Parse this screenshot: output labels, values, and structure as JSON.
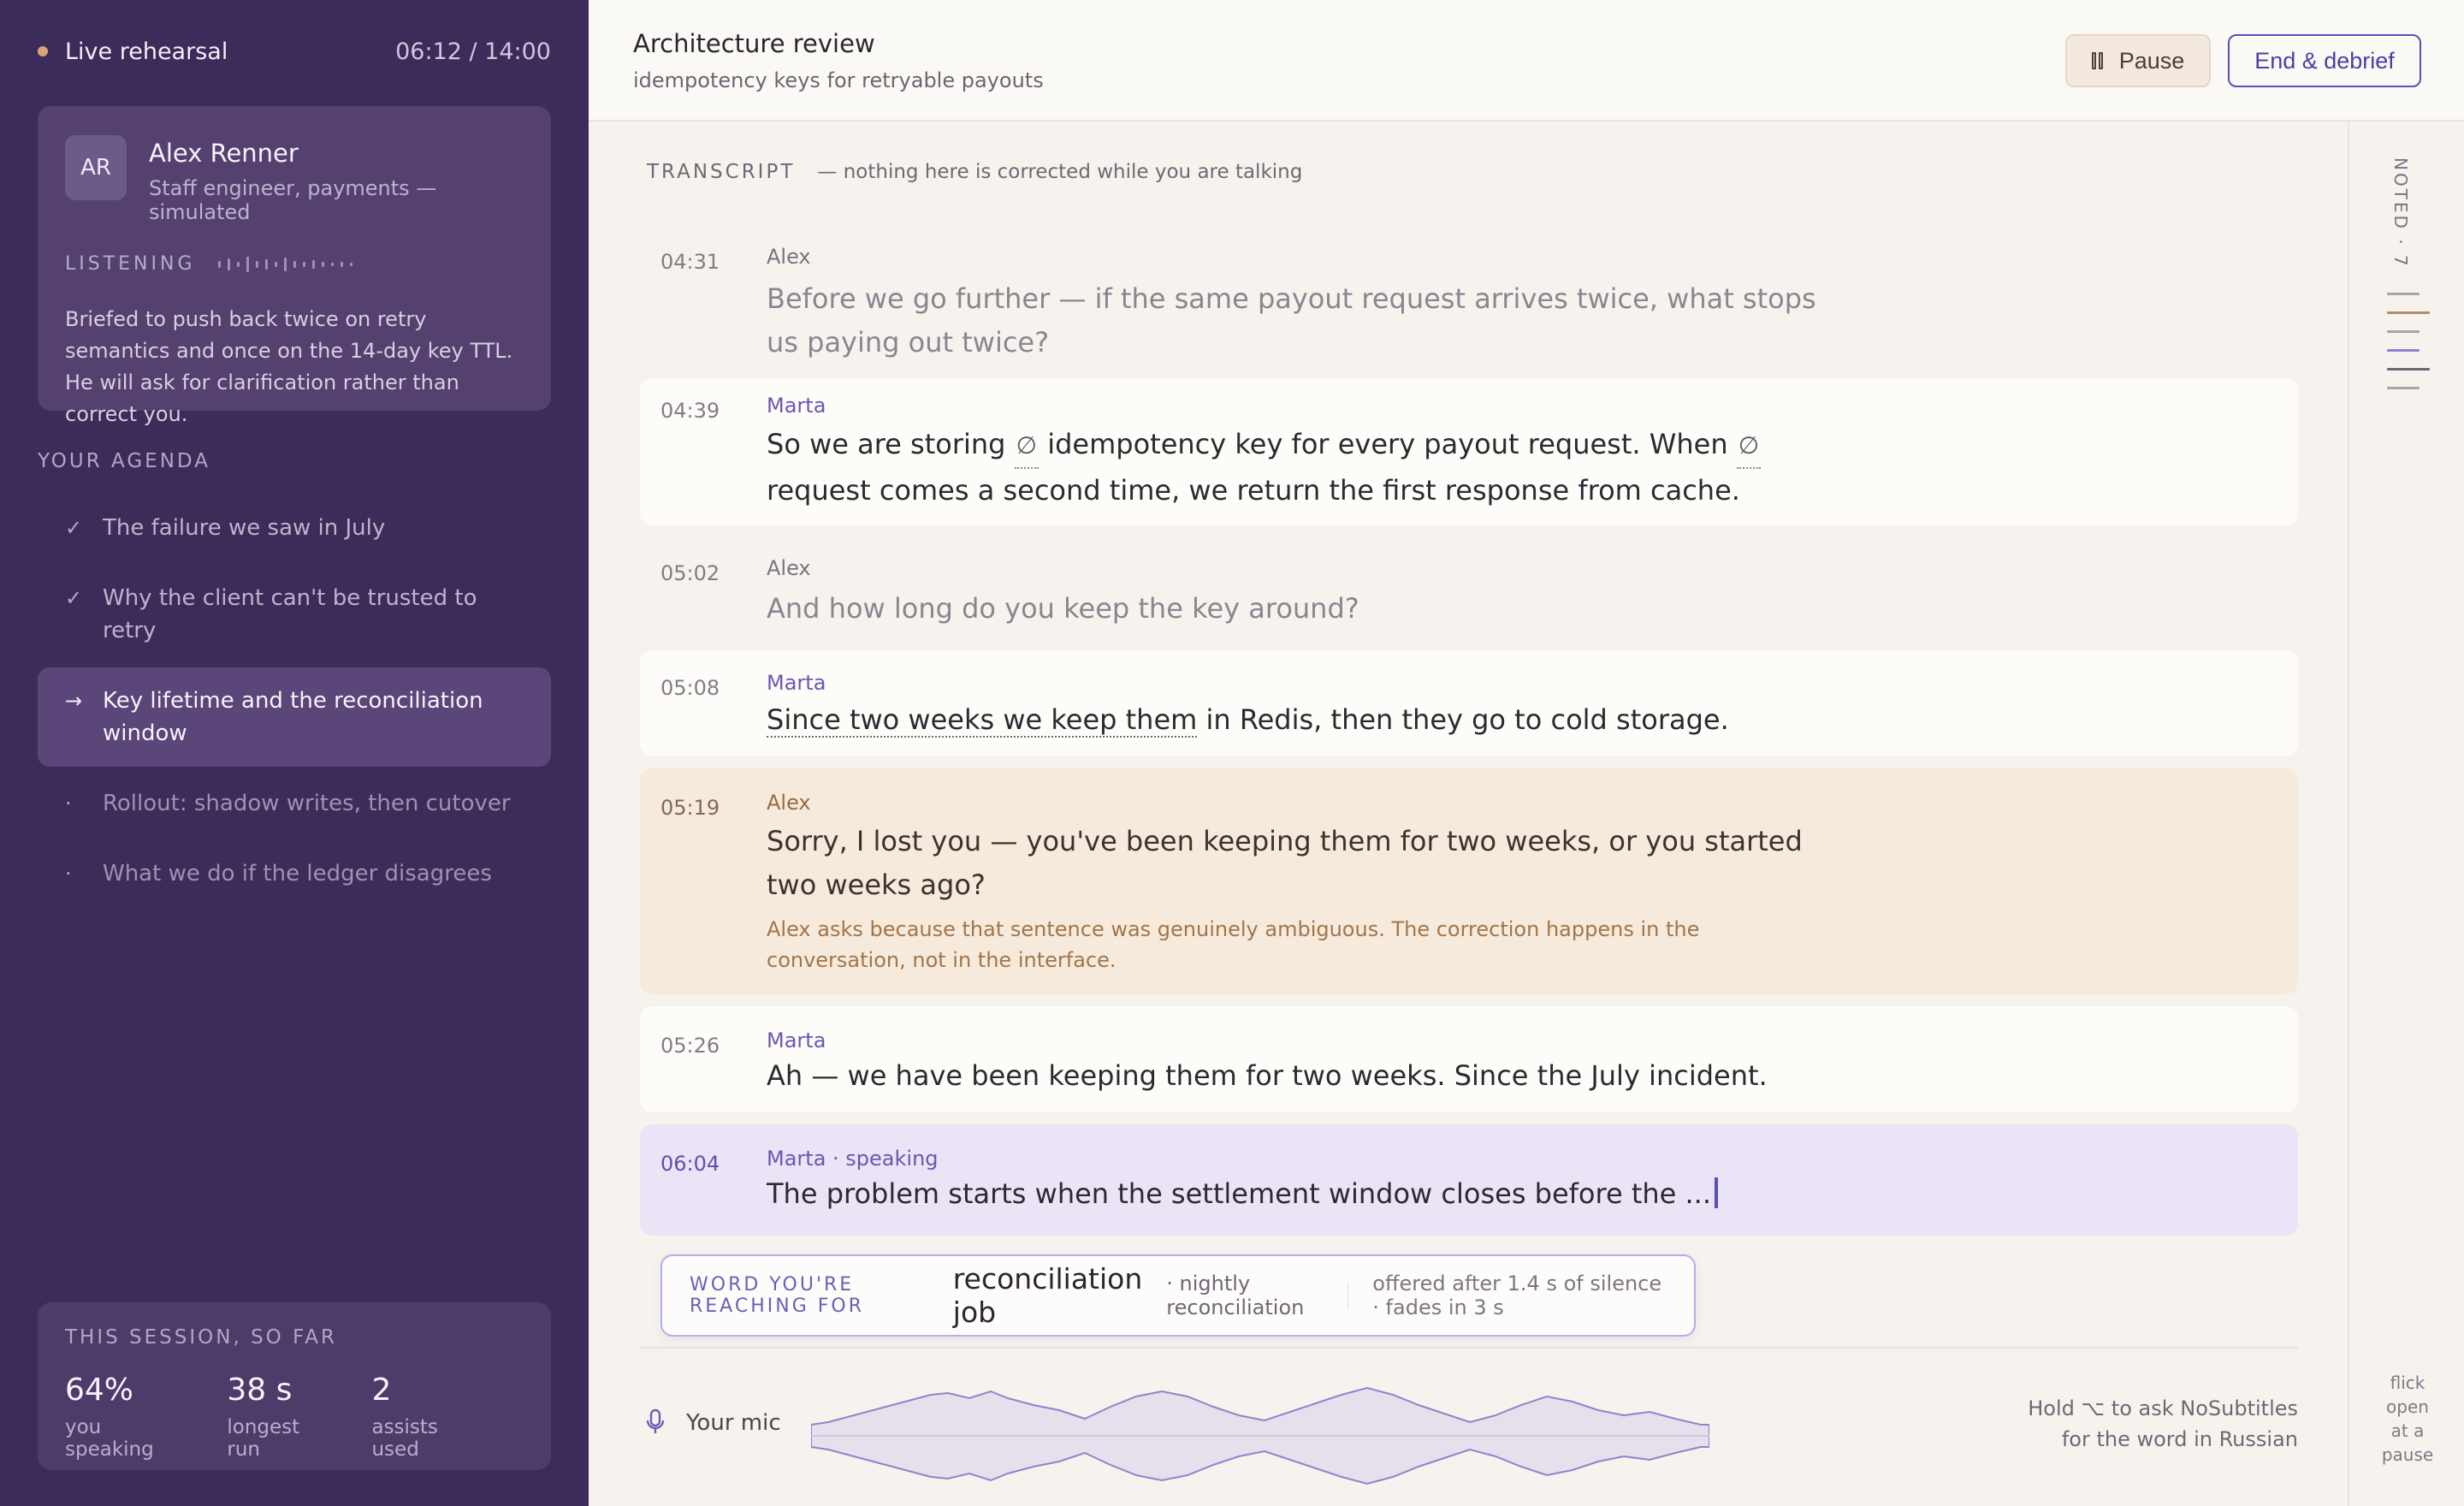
{
  "session": {
    "status": "Live rehearsal",
    "timer": "06:12 / 14:00"
  },
  "persona": {
    "initials": "AR",
    "name": "Alex Renner",
    "role": "Staff engineer, payments — simulated",
    "listening_label": "LISTENING",
    "brief": "Briefed to push back twice on retry semantics and once on the 14-day key TTL. He will ask for clarification rather than correct you."
  },
  "agenda": {
    "title": "YOUR AGENDA",
    "items": [
      {
        "label": "The failure we saw in July",
        "state": "done",
        "mark": "✓"
      },
      {
        "label": "Why the client can't be trusted to retry",
        "state": "done",
        "mark": "✓"
      },
      {
        "label": "Key lifetime and the reconciliation window",
        "state": "active",
        "mark": "→"
      },
      {
        "label": "Rollout: shadow writes, then cutover",
        "state": "pending",
        "mark": "·"
      },
      {
        "label": "What we do if the ledger disagrees",
        "state": "pending",
        "mark": "·"
      }
    ]
  },
  "stats": {
    "title": "THIS SESSION, SO FAR",
    "items": [
      {
        "value": "64%",
        "label": "you speaking"
      },
      {
        "value": "38 s",
        "label": "longest run"
      },
      {
        "value": "2",
        "label": "assists used"
      }
    ]
  },
  "header": {
    "title": "Architecture review",
    "subtitle": "idempotency keys for retryable payouts",
    "pause_label": "Pause",
    "end_label": "End & debrief"
  },
  "transcript": {
    "label": "TRANSCRIPT",
    "note": "— nothing here is corrected while you are talking",
    "turns": [
      {
        "time": "04:31",
        "speaker": "Alex",
        "text": "Before we go further — if the same payout request arrives twice, what stops us paying out twice?"
      },
      {
        "time": "04:39",
        "speaker": "Marta",
        "text_1": "So we are storing",
        "blank": "∅",
        "text_2": "idempotency key for every payout request. When",
        "text_3": "request comes a second time, we return the first response from cache."
      },
      {
        "time": "05:02",
        "speaker": "Alex",
        "text": "And how long do you keep the key around?"
      },
      {
        "time": "05:08",
        "speaker": "Marta",
        "text_ul": "Since two weeks we keep them",
        "text": "in Redis, then they go to cold storage."
      },
      {
        "time": "05:19",
        "speaker": "Alex",
        "text": "Sorry, I lost you — you've been keeping them for two weeks, or you started two weeks ago?",
        "note": "Alex asks because that sentence was genuinely ambiguous. The correction happens in the conversation, not in the interface."
      },
      {
        "time": "05:26",
        "speaker": "Marta",
        "text": "Ah — we have been keeping them for two weeks. Since the July incident."
      },
      {
        "time": "06:04",
        "speaker": "Marta · speaking",
        "text": "The problem starts when the settlement window closes before the ..."
      }
    ]
  },
  "suggestion": {
    "label": "WORD YOU'RE REACHING FOR",
    "word": "reconciliation job",
    "alternative": "· nightly reconciliation",
    "meta": "offered after 1.4 s of silence · fades in 3 s"
  },
  "mic": {
    "label": "Your mic",
    "hint_1": "Hold ⌥ to ask NoSubtitles",
    "hint_2": "for the word in Russian"
  },
  "rail": {
    "noted_label": "NOTED · 7",
    "flick_1": "flick",
    "flick_2": "open",
    "flick_3": "at a",
    "flick_4": "pause"
  },
  "colors": {
    "sidebar": "#3c2c59",
    "accent": "#5b4fb3",
    "amber": "#f6eadd",
    "live": "#ebe4f6"
  }
}
